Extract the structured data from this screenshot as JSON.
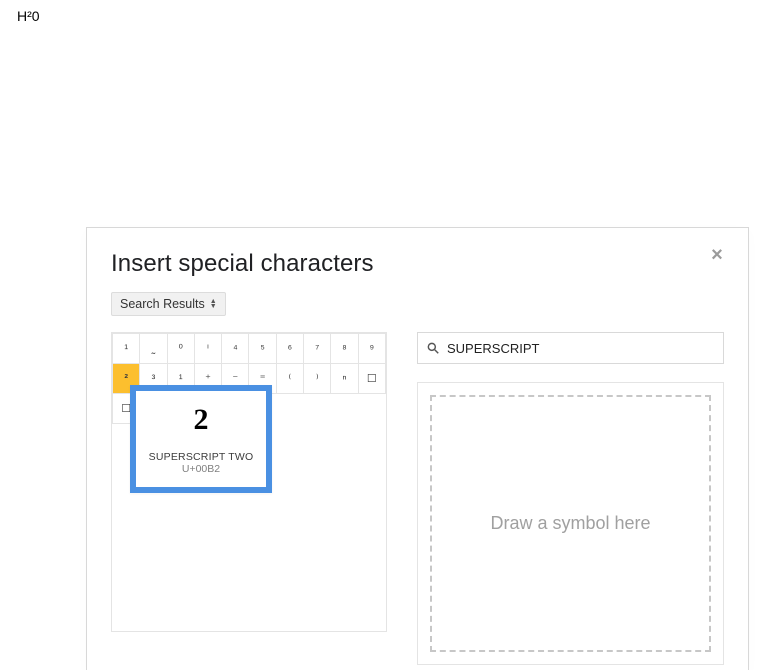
{
  "doc_text": "H²0",
  "dialog": {
    "title": "Insert special characters",
    "close_glyph": "×",
    "dropdown_label": "Search Results"
  },
  "grid": {
    "rows": [
      [
        "¹",
        "˷",
        "⁰",
        "ⁱ",
        "⁴",
        "⁵",
        "⁶",
        "⁷",
        "⁸",
        "⁹"
      ],
      [
        "²",
        "³",
        "¹",
        "⁺",
        "⁻",
        "⁼",
        "⁽",
        "⁾",
        "ⁿ",
        "☐"
      ],
      [
        "☐",
        "",
        "",
        "",
        "",
        "",
        "",
        "",
        "",
        ""
      ]
    ],
    "selected": {
      "row": 1,
      "col": 0
    }
  },
  "preview": {
    "char": "2",
    "name": "SUPERSCRIPT TWO",
    "code": "U+00B2"
  },
  "search": {
    "placeholder": "",
    "value": "SUPERSCRIPT"
  },
  "draw_hint": "Draw a symbol here"
}
